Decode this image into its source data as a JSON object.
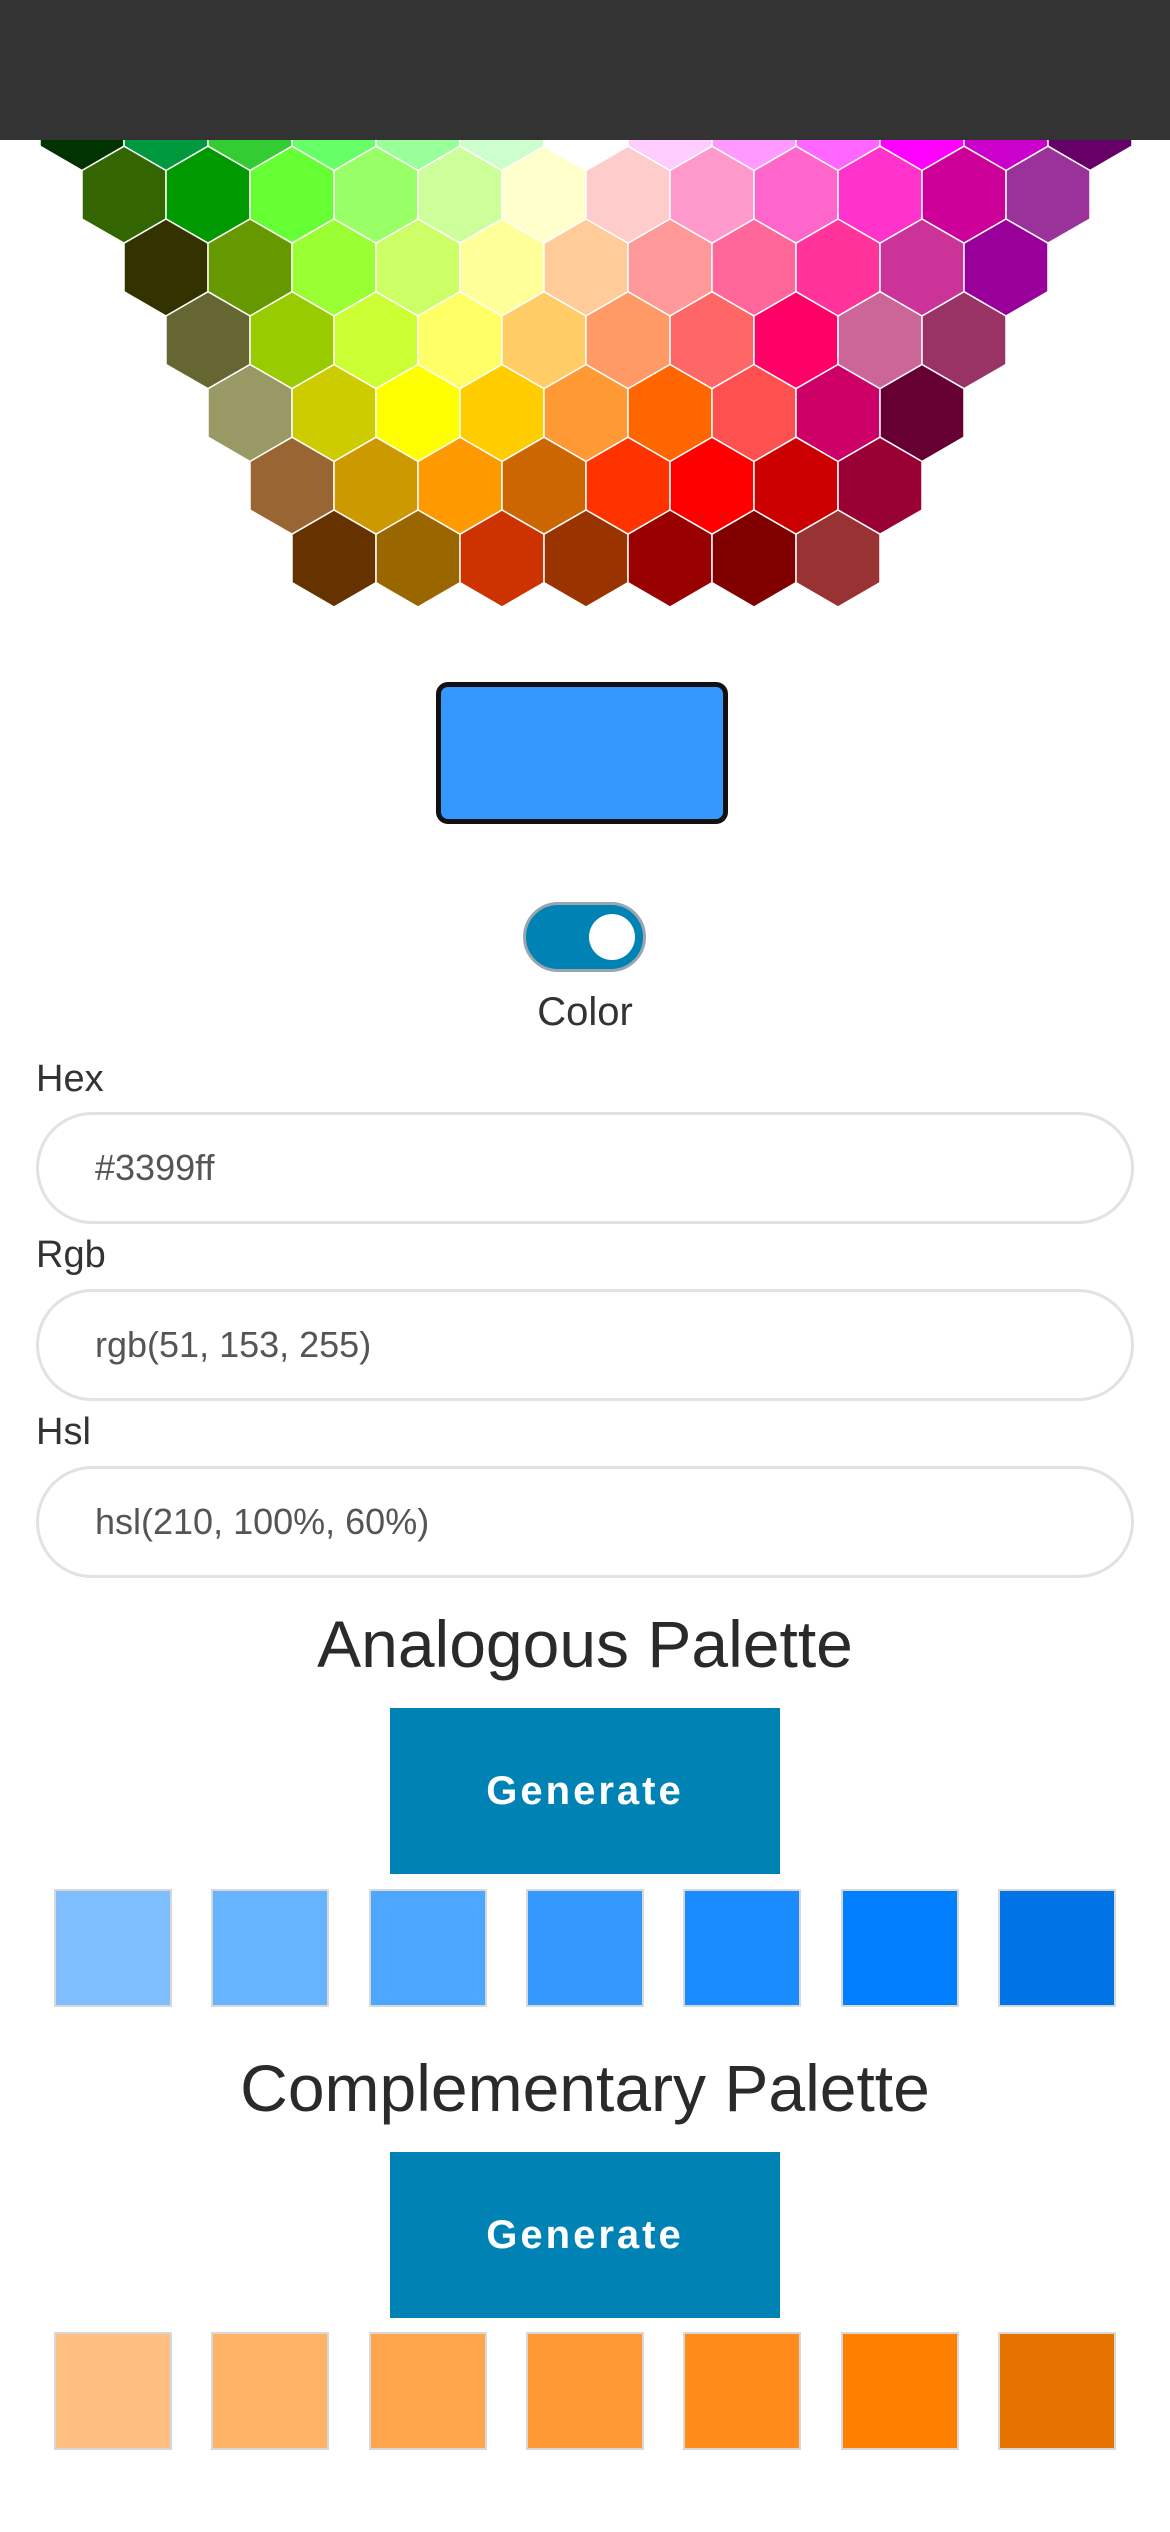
{
  "honeycomb": {
    "rows": [
      [
        "#003300",
        "#00993d",
        "#33cc33",
        "#66ff66",
        "#99ff99",
        "#ccffcc",
        "#ffffff",
        "#ffccff",
        "#ff99ff",
        "#ff66ff",
        "#ff00ff",
        "#cc00cc",
        "#660066"
      ],
      [
        "#336600",
        "#009900",
        "#66ff33",
        "#99ff66",
        "#ccff99",
        "#ffffcc",
        "#ffcccc",
        "#ff99cc",
        "#ff66cc",
        "#ff33cc",
        "#cc0099",
        "#993399"
      ],
      [
        "#333300",
        "#669900",
        "#99ff33",
        "#ccff66",
        "#ffff99",
        "#ffcc99",
        "#ff9999",
        "#ff6699",
        "#ff3399",
        "#cc3399",
        "#990099"
      ],
      [
        "#666633",
        "#99cc00",
        "#ccff33",
        "#ffff66",
        "#ffcc66",
        "#ff9966",
        "#ff6666",
        "#ff0066",
        "#cc6699",
        "#993366"
      ],
      [
        "#999966",
        "#cccc00",
        "#ffff00",
        "#ffcc00",
        "#ff9933",
        "#ff6600",
        "#ff5050",
        "#cc0066",
        "#660033"
      ],
      [
        "#996633",
        "#cc9900",
        "#ff9900",
        "#cc6600",
        "#ff3300",
        "#ff0000",
        "#cc0000",
        "#990033"
      ],
      [
        "#663300",
        "#996600",
        "#cc3300",
        "#993300",
        "#990000",
        "#800000",
        "#993333"
      ]
    ]
  },
  "preview": {
    "color": "#3399ff"
  },
  "toggle": {
    "label": "Color",
    "on": true
  },
  "fields": {
    "hex": {
      "label": "Hex",
      "value": "#3399ff"
    },
    "rgb": {
      "label": "Rgb",
      "value": "rgb(51, 153, 255)"
    },
    "hsl": {
      "label": "Hsl",
      "value": "hsl(210, 100%, 60%)"
    }
  },
  "analogous": {
    "title": "Analogous Palette",
    "button_label": "Generate",
    "swatches": [
      "#80bfff",
      "#66b3ff",
      "#4da6ff",
      "#3399ff",
      "#1a8cff",
      "#0080ff",
      "#0073e6"
    ]
  },
  "complementary": {
    "title": "Complementary Palette",
    "button_label": "Generate",
    "swatches": [
      "#ffbf80",
      "#ffb366",
      "#ffa64d",
      "#ff9933",
      "#ff8c1a",
      "#ff8000",
      "#e67300"
    ]
  }
}
